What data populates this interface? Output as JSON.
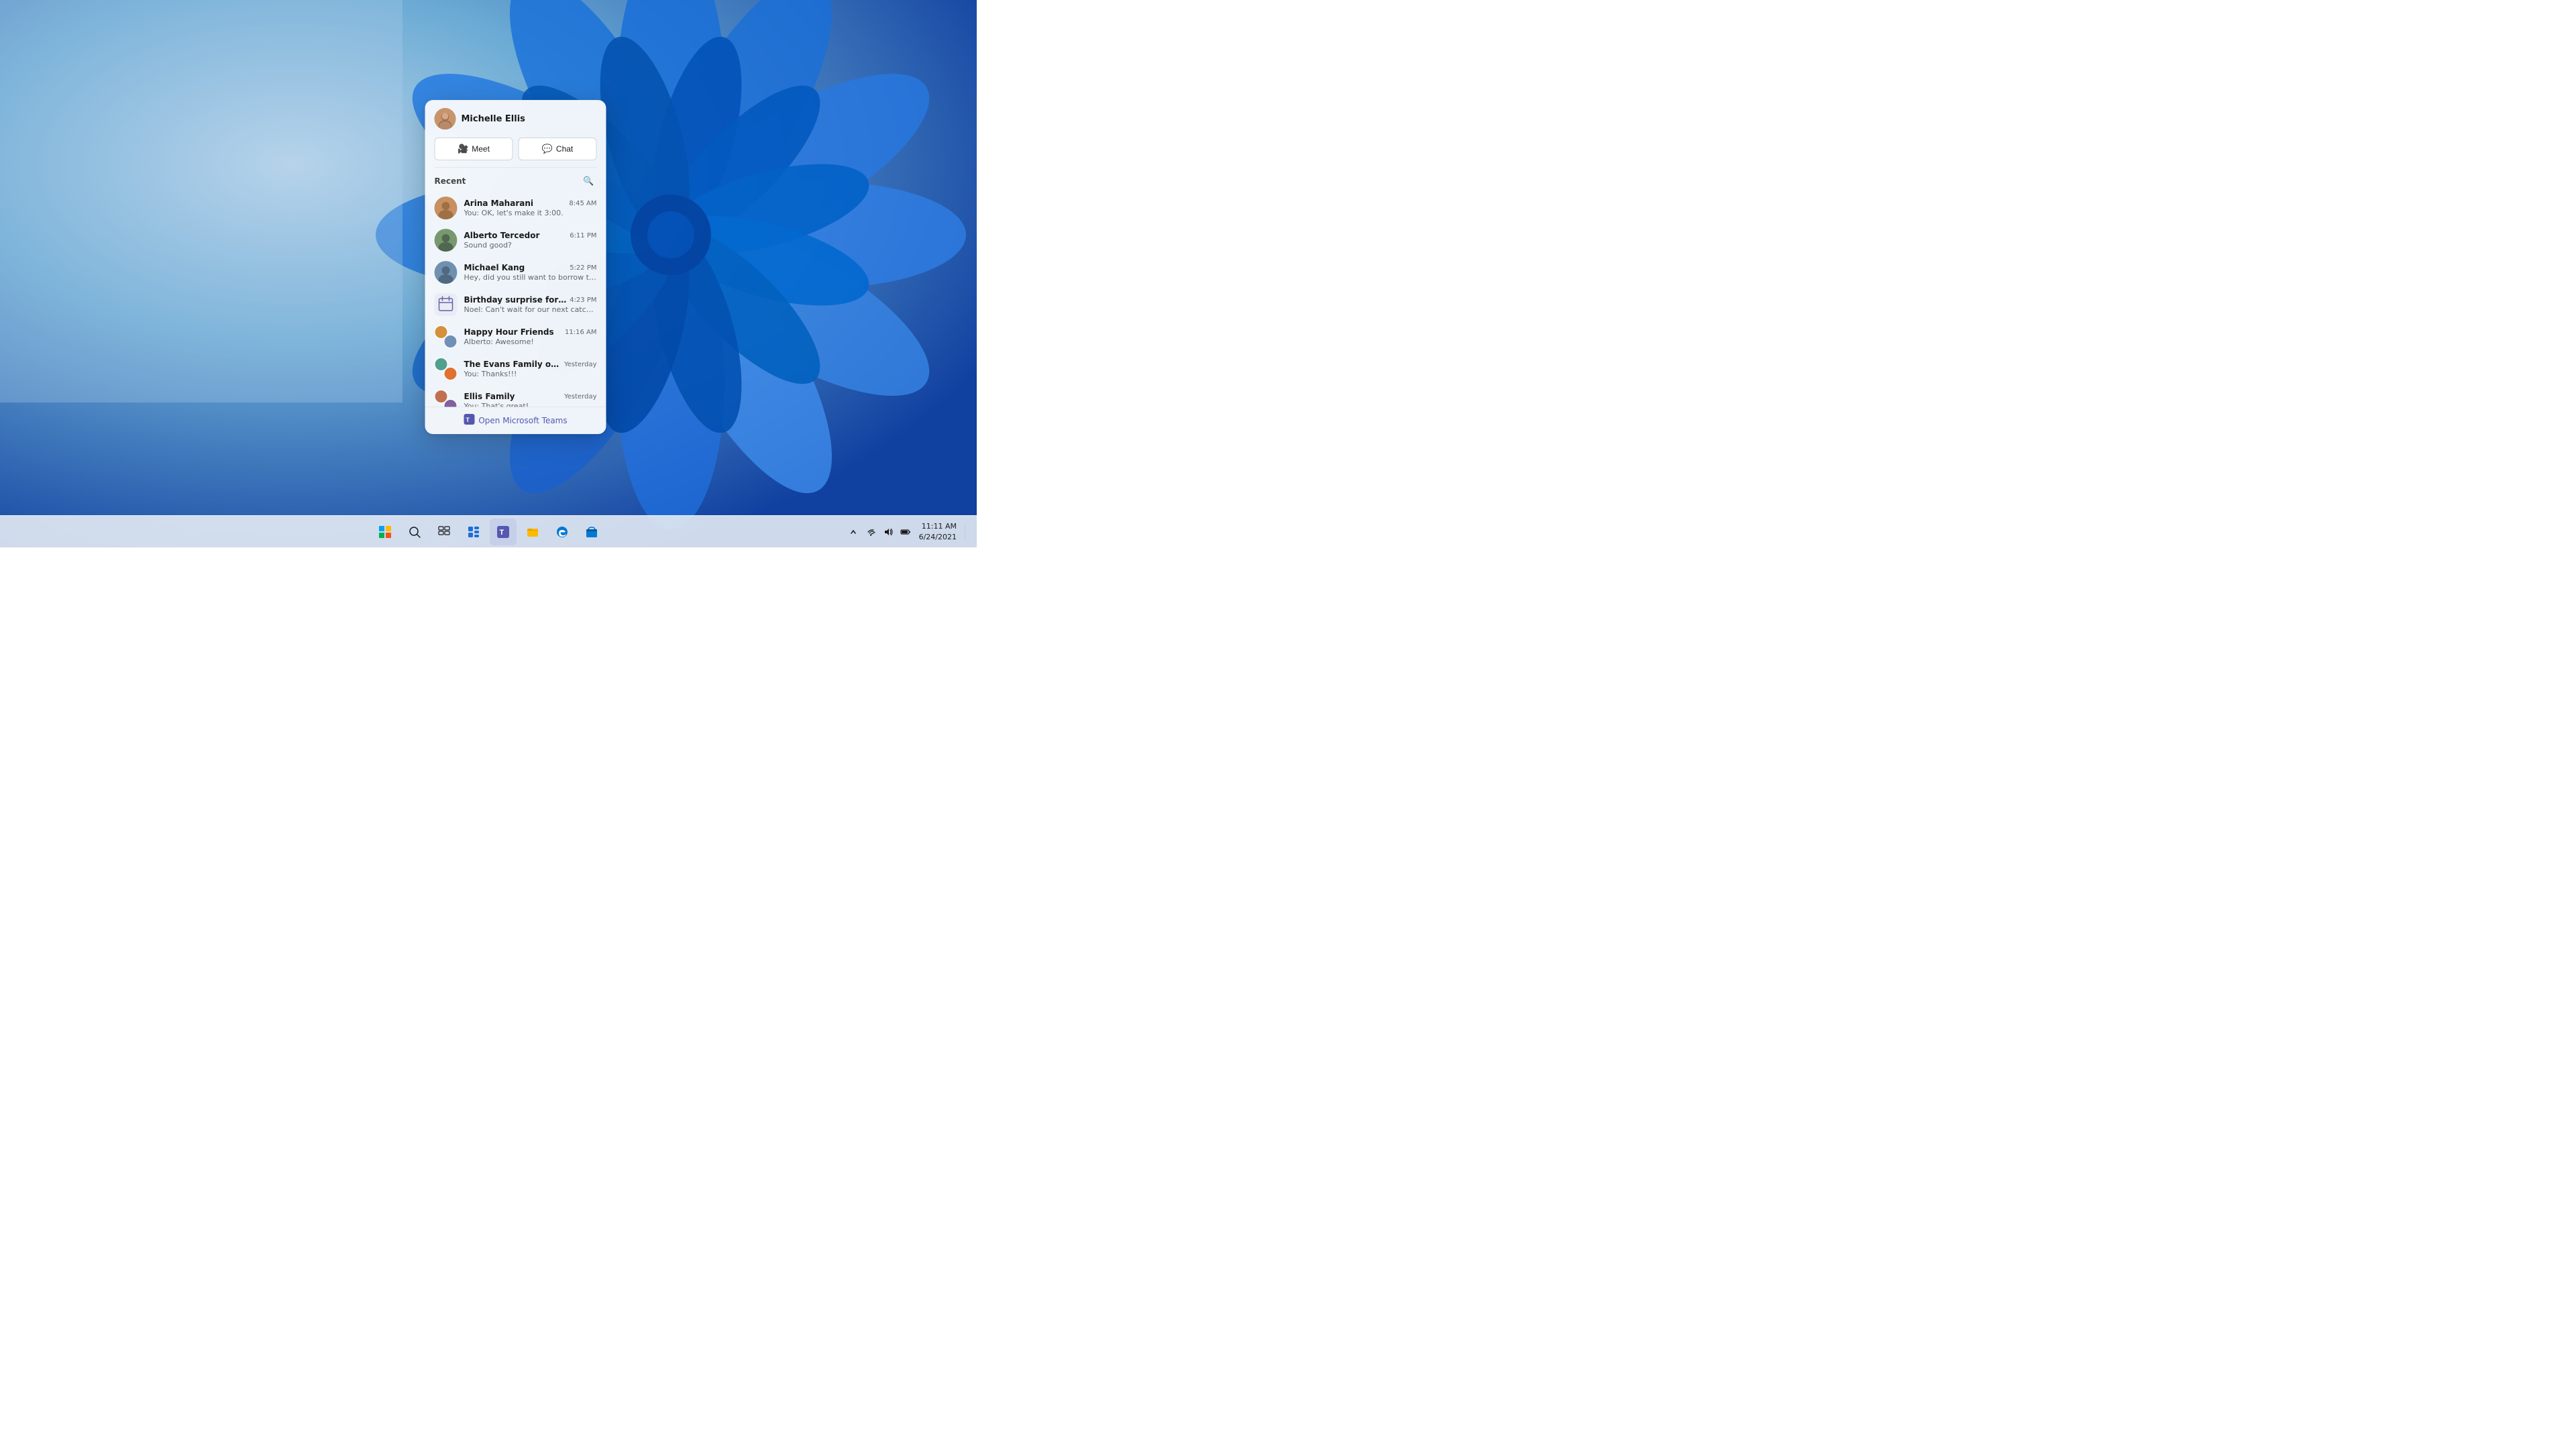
{
  "desktop": {
    "background_color_start": "#a8c8e8",
    "background_color_end": "#003880"
  },
  "popup": {
    "user": {
      "name": "Michelle Ellis",
      "avatar_emoji": "👩"
    },
    "buttons": {
      "meet_label": "Meet",
      "chat_label": "Chat"
    },
    "recent_label": "Recent",
    "search_icon": "🔍",
    "chat_items": [
      {
        "name": "Arina Maharani",
        "preview": "You: OK, let's make it 3:00.",
        "time": "8:45 AM",
        "avatar_color": "#c8a07a",
        "type": "person"
      },
      {
        "name": "Alberto Tercedor",
        "preview": "Sound good?",
        "time": "6:11 PM",
        "avatar_color": "#7a9a6a",
        "type": "person"
      },
      {
        "name": "Michael Kang",
        "preview": "Hey, did you still want to borrow the notes?",
        "time": "5:22 PM",
        "avatar_color": "#6a8aaa",
        "type": "person"
      },
      {
        "name": "Birthday surprise for Mum",
        "preview": "Noel: Can't wait for our next catch up!",
        "time": "4:23 PM",
        "avatar_color": "#9a7abc",
        "type": "calendar"
      },
      {
        "name": "Happy Hour Friends",
        "preview": "Alberto: Awesome!",
        "time": "11:16 AM",
        "avatar_color": "#e0a040",
        "type": "group"
      },
      {
        "name": "The Evans Family of Supers",
        "preview": "You: Thanks!!!",
        "time": "Yesterday",
        "avatar_color": "#50a090",
        "type": "group"
      },
      {
        "name": "Ellis Family",
        "preview": "You: That's great!",
        "time": "Yesterday",
        "avatar_color": "#c07050",
        "type": "group"
      }
    ],
    "footer_label": "Open Microsoft Teams"
  },
  "taskbar": {
    "left_icons": [
      "⬡"
    ],
    "center_icons": [
      {
        "name": "start-button",
        "symbol": "⊞"
      },
      {
        "name": "search-button",
        "symbol": "🔍"
      },
      {
        "name": "task-view-button",
        "symbol": "❑"
      },
      {
        "name": "widgets-button",
        "symbol": "⊟"
      },
      {
        "name": "teams-button",
        "symbol": "💬"
      },
      {
        "name": "file-explorer-button",
        "symbol": "📁"
      },
      {
        "name": "edge-button",
        "symbol": "🌐"
      },
      {
        "name": "store-button",
        "symbol": "🛍"
      }
    ],
    "clock": {
      "time": "11:11 AM",
      "date": "6/24/2021"
    },
    "tray": {
      "expand_label": "^",
      "wifi_icon": "wifi",
      "speaker_icon": "speaker",
      "battery_icon": "battery"
    }
  }
}
